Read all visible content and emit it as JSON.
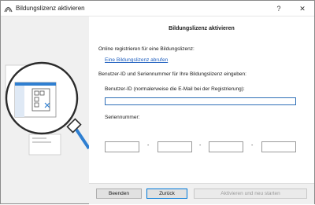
{
  "window": {
    "title": "Bildungslizenz aktivieren",
    "help_glyph": "?",
    "close_glyph": "✕",
    "app_icon": "archicad-arc-icon"
  },
  "main": {
    "heading": "Bildungslizenz aktivieren",
    "online_label": "Online registrieren für eine Bildungslizenz:",
    "link_text": "Eine Bildungslizenz abrufen",
    "instructions": "Benutzer-ID und Seriennummer für Ihre Bildungslizenz eingeben:",
    "userid_label": "Benutzer-ID (normalerweise die E-Mail bei der Registrierung):",
    "userid_value": "",
    "serial_label": "Seriennummer:",
    "serial_parts": [
      "",
      "",
      "",
      ""
    ],
    "dash": "-"
  },
  "footer": {
    "back_label": "Beenden",
    "prev_label": "Zurück",
    "activate_label": "Aktivieren und neu starten"
  },
  "colors": {
    "accent": "#0078d7",
    "link": "#1f5fbf",
    "panel_bg": "#f0f0f0",
    "illustration_blue": "#2f7fd1"
  }
}
